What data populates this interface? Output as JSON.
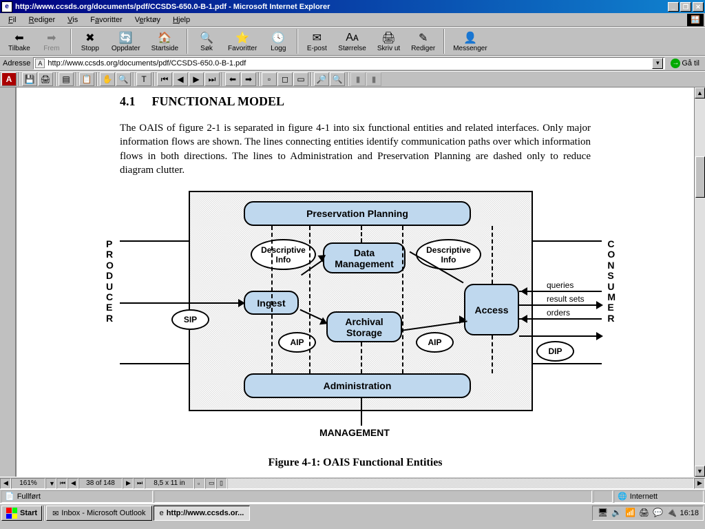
{
  "window": {
    "title": "http://www.ccsds.org/documents/pdf/CCSDS-650.0-B-1.pdf - Microsoft Internet Explorer",
    "minimize": "_",
    "maximize": "❐",
    "close": "✕"
  },
  "menu": {
    "fil": "Fil",
    "rediger": "Rediger",
    "vis": "Vis",
    "favoritter": "Favoritter",
    "verktoy": "Verktøy",
    "hjelp": "Hjelp"
  },
  "toolbar": {
    "tilbake": "Tilbake",
    "frem": "Frem",
    "stopp": "Stopp",
    "oppdater": "Oppdater",
    "startside": "Startside",
    "sok": "Søk",
    "favoritter": "Favoritter",
    "logg": "Logg",
    "epost": "E-post",
    "storrelse": "Størrelse",
    "skrivut": "Skriv ut",
    "rediger": "Rediger",
    "messenger": "Messenger"
  },
  "address": {
    "label": "Adresse",
    "url": "http://www.ccsds.org/documents/pdf/CCSDS-650.0-B-1.pdf",
    "go": "Gå til",
    "go_icon": "→"
  },
  "pdfbar": {
    "zoom": "161%",
    "page": "38 of 148",
    "pagesize": "8,5 x 11 in"
  },
  "doc": {
    "secnum": "4.1",
    "sectitle": "FUNCTIONAL MODEL",
    "para": "The OAIS of figure 2-1 is separated in figure 4-1 into six functional entities and related interfaces.  Only major information flows are shown.  The lines connecting entities identify communication paths over which information flows in both directions.  The lines to Administration and Preservation Planning are dashed only to reduce diagram clutter.",
    "caption": "Figure 4-1:  OAIS Functional Entities"
  },
  "diagram": {
    "preservation": "Preservation Planning",
    "datamgmt": "Data\nManagement",
    "ingest": "Ingest",
    "archival": "Archival\nStorage",
    "access": "Access",
    "admin": "Administration",
    "desc1": "Descriptive\nInfo",
    "desc2": "Descriptive\nInfo",
    "sip": "SIP",
    "aip1": "AIP",
    "aip2": "AIP",
    "dip": "DIP",
    "producer": "PRODUCER",
    "consumer": "CONSUMER",
    "management": "MANAGEMENT",
    "queries": "queries",
    "resultsets": "result sets",
    "orders": "orders"
  },
  "iestatus": {
    "done": "Fullført",
    "zone": "Internett"
  },
  "taskbar": {
    "start": "Start",
    "inbox": "Inbox - Microsoft Outlook",
    "ie": "http://www.ccsds.or...",
    "clock": "16:18"
  }
}
